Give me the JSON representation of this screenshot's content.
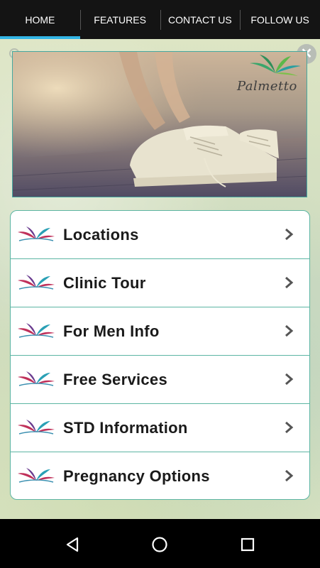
{
  "tabs": [
    {
      "label": "HOME",
      "active": true
    },
    {
      "label": "FEATURES",
      "active": false
    },
    {
      "label": "CONTACT US",
      "active": false
    },
    {
      "label": "FOLLOW US",
      "active": false
    }
  ],
  "banner": {
    "logo_text": "Palmetto",
    "icon": "palm-leaf-logo"
  },
  "controls": {
    "refresh_icon": "refresh-icon",
    "close_icon": "close-icon"
  },
  "menu": {
    "items": [
      {
        "label": "Locations"
      },
      {
        "label": "Clinic Tour"
      },
      {
        "label": "For Men Info"
      },
      {
        "label": "Free Services"
      },
      {
        "label": "STD Information"
      },
      {
        "label": "Pregnancy Options"
      }
    ]
  },
  "system_nav": {
    "back": "back-icon",
    "home": "home-icon",
    "recents": "recents-icon"
  },
  "colors": {
    "accent": "#33b5e5",
    "border": "#5cb5a3",
    "nav_bg": "#141414"
  }
}
